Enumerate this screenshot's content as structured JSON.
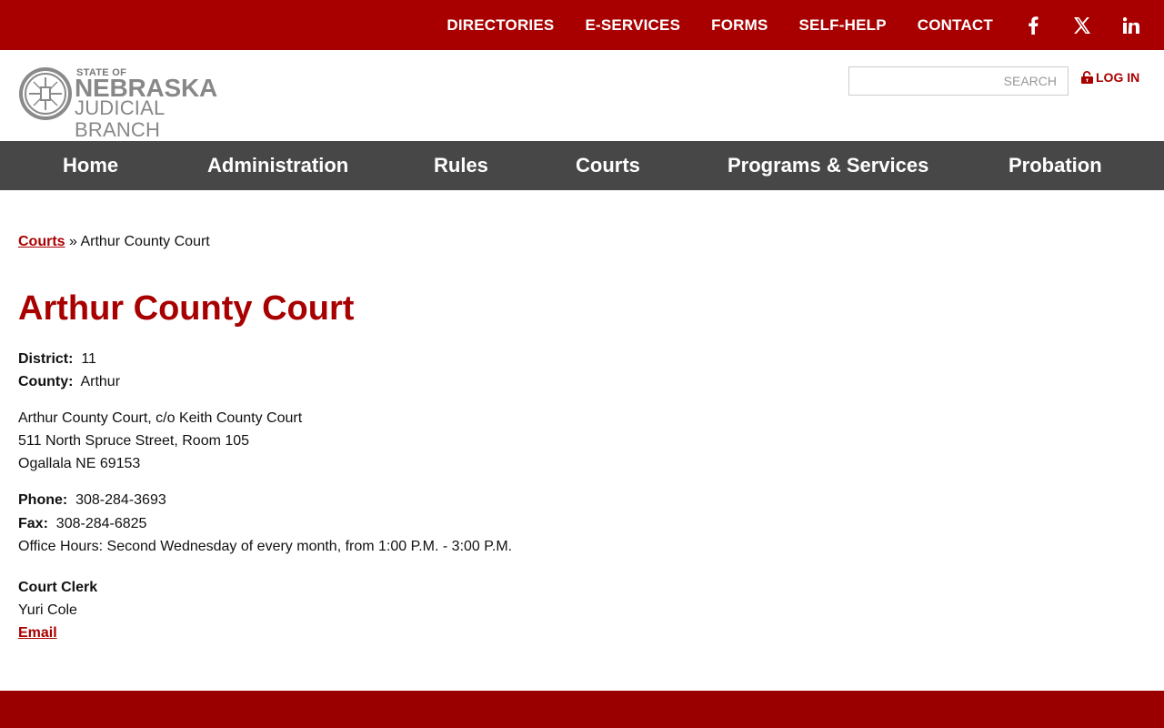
{
  "topnav": {
    "items": [
      "DIRECTORIES",
      "E-SERVICES",
      "FORMS",
      "SELF-HELP",
      "CONTACT"
    ],
    "social": [
      "facebook-icon",
      "x-twitter-icon",
      "linkedin-icon"
    ]
  },
  "logo": {
    "small": "STATE OF",
    "big": "NEBRASKA",
    "sub": "JUDICIAL BRANCH"
  },
  "search": {
    "placeholder": "SEARCH"
  },
  "login": {
    "label": "LOG IN"
  },
  "mainnav": {
    "items": [
      "Home",
      "Administration",
      "Rules",
      "Courts",
      "Programs & Services",
      "Probation"
    ]
  },
  "breadcrumb": {
    "link": "Courts",
    "separator": " » ",
    "current": "Arthur County Court"
  },
  "page": {
    "title": "Arthur County Court",
    "district_label": "District:",
    "district_value": "11",
    "county_label": "County:",
    "county_value": "Arthur",
    "address1": "Arthur County Court, c/o Keith County Court",
    "address2": "511 North Spruce Street, Room 105",
    "address3": "Ogallala NE 69153",
    "phone_label": "Phone:",
    "phone_value": "308-284-3693",
    "fax_label": "Fax:",
    "fax_value": "308-284-6825",
    "hours": "Office Hours: Second Wednesday of every month, from 1:00 P.M. - 3:00 P.M.",
    "clerk_heading": "Court Clerk",
    "clerk_name": "Yuri Cole",
    "email_label": "Email"
  },
  "colors": {
    "brand_red": "#a80000",
    "nav_gray": "#474747",
    "footer_red": "#9a0000"
  }
}
